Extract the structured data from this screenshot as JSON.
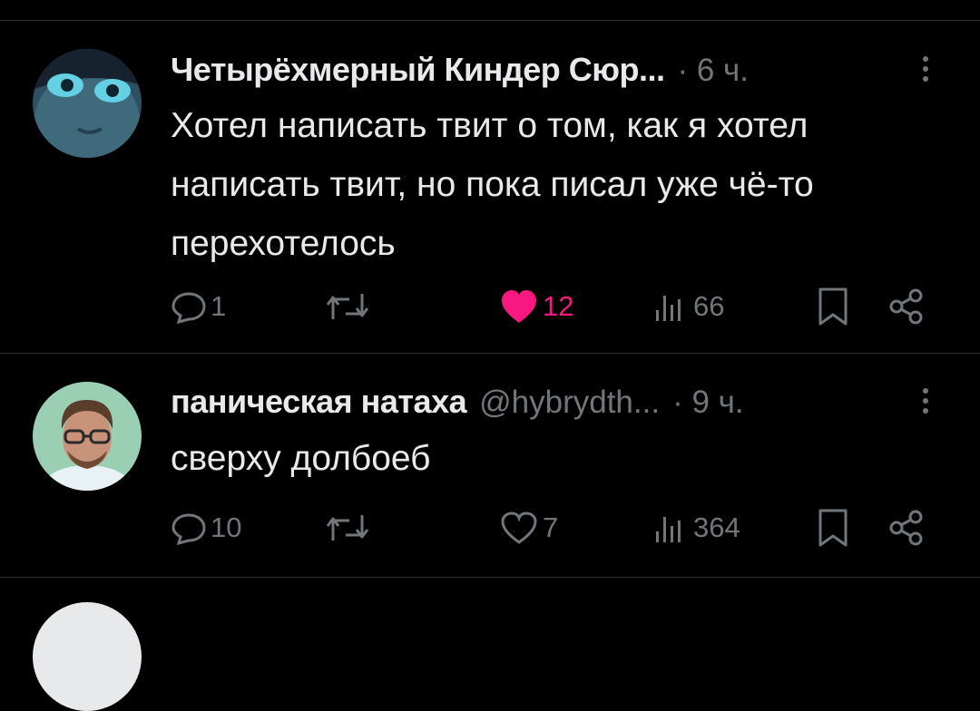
{
  "tweets": [
    {
      "author_name": "Четырёхмерный Киндер Сюр...",
      "handle": "",
      "time": "· 6 ч.",
      "text": "Хотел написать твит о том, как я хотел\nнаписать твит, но пока писал уже чё-то\nперехотелось",
      "replies": "1",
      "retweets": "",
      "likes": "12",
      "liked": true,
      "views": "66"
    },
    {
      "author_name": "паническая натаха",
      "handle": "@hybrydth...",
      "time": "· 9 ч.",
      "text": "сверху долбоеб",
      "replies": "10",
      "retweets": "",
      "likes": "7",
      "liked": false,
      "views": "364"
    }
  ],
  "colors": {
    "background": "#000000",
    "text": "#e7e9ea",
    "muted": "#71767b",
    "like_active": "#f91880",
    "divider": "#2f3336"
  },
  "icons": [
    "reply-icon",
    "retweet-icon",
    "like-icon",
    "views-icon",
    "bookmark-icon",
    "share-icon",
    "more-icon"
  ]
}
